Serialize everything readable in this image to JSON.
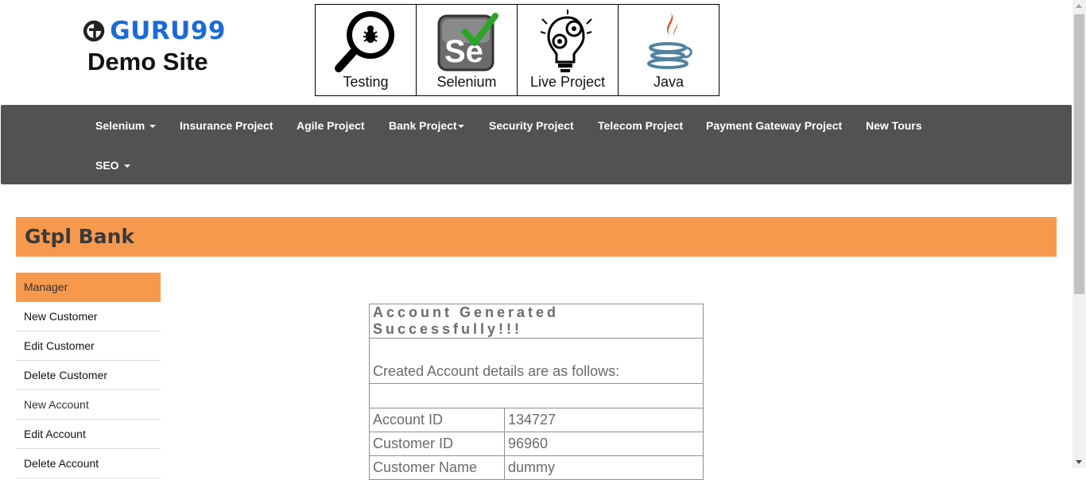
{
  "header": {
    "logo_text": "GURU99",
    "site_title": "Demo Site",
    "topics": [
      {
        "label": "Testing",
        "icon": "magnifier-bug-icon"
      },
      {
        "label": "Selenium",
        "icon": "selenium-check-icon"
      },
      {
        "label": "Live Project",
        "icon": "lightbulb-gears-icon"
      },
      {
        "label": "Java",
        "icon": "java-cup-icon"
      }
    ]
  },
  "navbar": {
    "items": [
      {
        "label": "Selenium",
        "dropdown": true
      },
      {
        "label": "Insurance Project",
        "dropdown": false
      },
      {
        "label": "Agile Project",
        "dropdown": false
      },
      {
        "label": "Bank Project",
        "dropdown": true
      },
      {
        "label": "Security Project",
        "dropdown": false
      },
      {
        "label": "Telecom Project",
        "dropdown": false
      },
      {
        "label": "Payment Gateway Project",
        "dropdown": false
      },
      {
        "label": "New Tours",
        "dropdown": false
      },
      {
        "label": "SEO",
        "dropdown": true
      }
    ]
  },
  "bank": {
    "title": "Gtpl Bank"
  },
  "side_menu": {
    "items": [
      "Manager",
      "New Customer",
      "Edit Customer",
      "Delete Customer",
      "New Account",
      "Edit Account",
      "Delete Account"
    ],
    "active": "Manager"
  },
  "result": {
    "success": "Account Generated Successfully!!!",
    "details_heading": "Created Account details are as follows:",
    "rows": [
      {
        "key": "Account ID",
        "value": "134727"
      },
      {
        "key": "Customer ID",
        "value": "96960"
      },
      {
        "key": "Customer Name",
        "value": "dummy"
      }
    ]
  },
  "colors": {
    "brand_blue": "#1b6ad9",
    "accent_orange": "#f7994d",
    "navbar_gray": "#525252",
    "success_green": "#2e7d12"
  }
}
